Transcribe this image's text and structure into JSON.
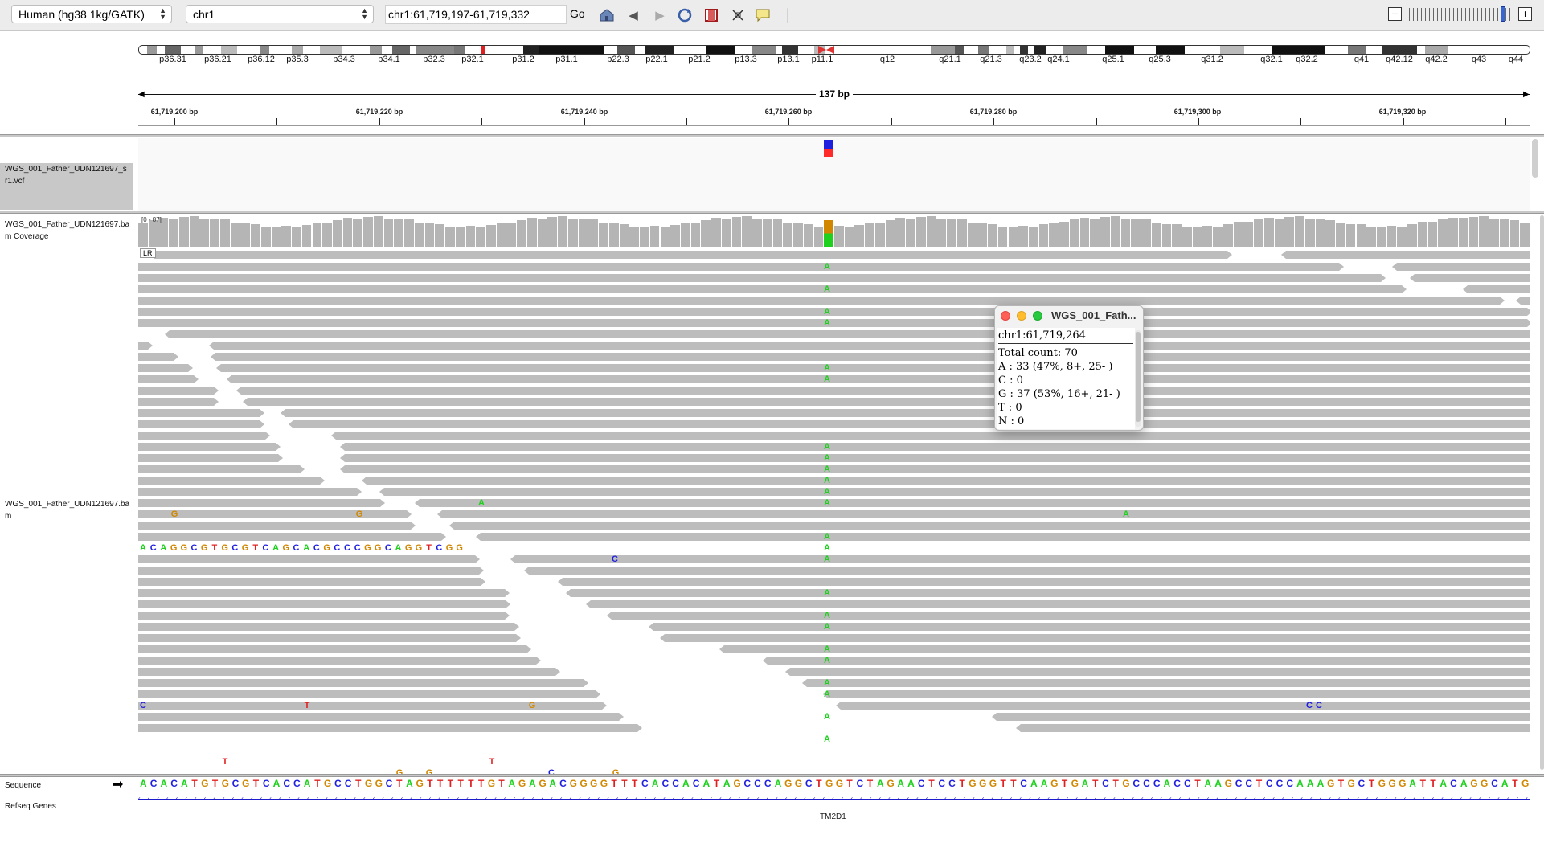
{
  "toolbar": {
    "genome": "Human (hg38 1kg/GATK)",
    "chromosome": "chr1",
    "locus": "chr1:61,719,197-61,719,332",
    "go_label": "Go"
  },
  "ideogram": {
    "labels": [
      "p36.31",
      "p36.21",
      "p36.12",
      "p35.3",
      "p34.3",
      "p34.1",
      "p32.3",
      "p32.1",
      "p31.2",
      "p31.1",
      "p22.3",
      "p22.1",
      "p21.2",
      "p13.3",
      "p13.1",
      "p11.1",
      "q12",
      "q21.1",
      "q21.3",
      "q23.2",
      "q24.1",
      "q25.1",
      "q25.3",
      "q31.2",
      "q32.1",
      "q32.2",
      "q41",
      "q42.12",
      "q42.2",
      "q43",
      "q44"
    ]
  },
  "ruler": {
    "span": "137 bp",
    "labels": [
      "61,719,200 bp",
      "61,719,220 bp",
      "61,719,240 bp",
      "61,719,260 bp",
      "61,719,280 bp",
      "61,719,300 bp",
      "61,719,320 bp"
    ]
  },
  "tracks": {
    "vcf_name": "WGS_001_Father_UDN121697_sr1.vcf",
    "coverage_name": "WGS_001_Father_UDN121697.bam Coverage",
    "coverage_range": "[0 - 87]",
    "bam_name": "WGS_001_Father_UDN121697.bam",
    "lr_badge": "LR",
    "sequence_name": "Sequence",
    "refseq_name": "Refseq Genes",
    "gene_label": "TM2D1"
  },
  "softclip_text": "ACAGGCGTGCGTCAGCACGCCCGGCAGGTCGG",
  "sequence": "ACACATGTGCGTCACCATGCCTGGCTAGTTTTTTGTAGAGACGGGGTTTCACCACATAGCCCAGGCTGGTCTAGAACTCCTGGGTTCAAGTGATCTGCCCACCTAAGCCTCCCAAAGTGCTGGGATTACAGGCATG",
  "popup": {
    "title": "WGS_001_Fath...",
    "position": "chr1:61,719,264",
    "total": "Total count: 70",
    "a": "A : 33 (47%, 8+, 25- )",
    "c": "C : 0",
    "g": "G : 37 (53%, 16+, 21- )",
    "t": "T : 0",
    "n": "N : 0"
  },
  "colors": {
    "A": "#1fd01f",
    "C": "#1f1fe0",
    "G": "#d18700",
    "T": "#e02020",
    "read": "#bdbdbd",
    "coverage": "#b5b5b5",
    "vcf_top": "#1f1fe0",
    "vcf_bottom": "#ff2a2a"
  }
}
